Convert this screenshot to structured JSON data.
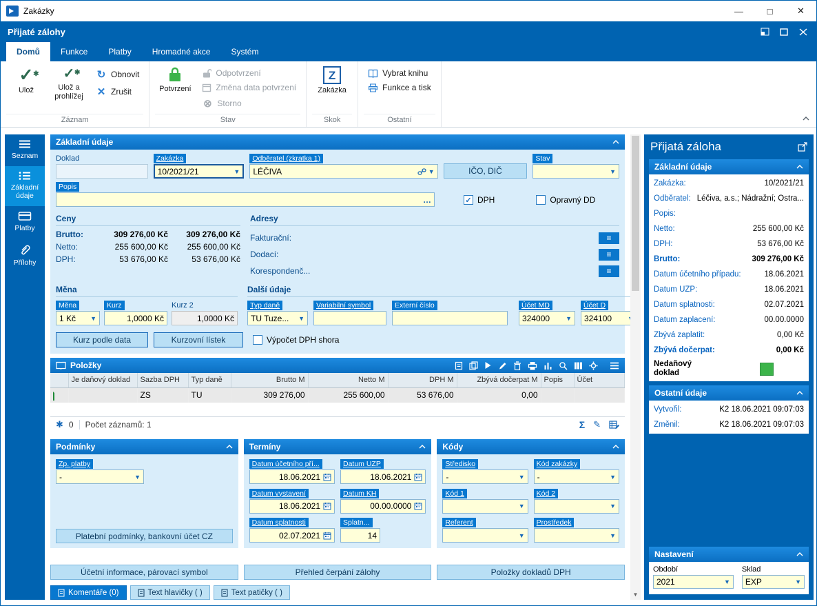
{
  "titlebar": {
    "title": "Zakázky"
  },
  "appbar": {
    "title": "Přijaté zálohy"
  },
  "ribbon": {
    "tabs": [
      {
        "label": "Domů"
      },
      {
        "label": "Funkce"
      },
      {
        "label": "Platby"
      },
      {
        "label": "Hromadné akce"
      },
      {
        "label": "Systém"
      }
    ],
    "buttons": {
      "save": "Ulož",
      "save_and_view": "Ulož a prohlížej",
      "refresh": "Obnovit",
      "cancel": "Zrušit",
      "confirm": "Potvrzení",
      "unconfirm": "Odpotvrzení",
      "change_confirm_date": "Změna data potvrzení",
      "storno": "Storno",
      "jump_zakazka": "Zakázka",
      "z_letter": "Z",
      "select_book": "Vybrat knihu",
      "functions_print": "Funkce a tisk"
    },
    "groups": {
      "zaznam": "Záznam",
      "stav": "Stav",
      "skok": "Skok",
      "ostatni": "Ostatní"
    }
  },
  "sidebar": {
    "items": [
      {
        "label": "Seznam"
      },
      {
        "label": "Základní údaje"
      },
      {
        "label": "Platby"
      },
      {
        "label": "Přílohy"
      }
    ]
  },
  "form": {
    "title": "Základní údaje",
    "doklad_label": "Doklad",
    "zakazka_label": "Zakázka",
    "zakazka_value": "10/2021/21",
    "odberatel_label": "Odběratel (zkratka 1)",
    "odberatel_value": "LÉČIVA",
    "ico_dic_button": "IČO, DIČ",
    "stav_label": "Stav",
    "popis_label": "Popis",
    "dph_checkbox": "DPH",
    "opravny_dd_checkbox": "Opravný DD",
    "ceny": {
      "title": "Ceny",
      "rows": [
        {
          "label": "Brutto:",
          "v1": "309 276,00 Kč",
          "v2": "309 276,00 Kč"
        },
        {
          "label": "Netto:",
          "v1": "255 600,00 Kč",
          "v2": "255 600,00 Kč"
        },
        {
          "label": "DPH:",
          "v1": "53 676,00 Kč",
          "v2": "53 676,00 Kč"
        }
      ]
    },
    "adresy": {
      "title": "Adresy",
      "rows": [
        {
          "label": "Fakturační:"
        },
        {
          "label": "Dodací:"
        },
        {
          "label": "Korespondenč..."
        }
      ]
    },
    "mena": {
      "title": "Měna",
      "mena_label": "Měna",
      "mena_value": "1 Kč",
      "kurz_label": "Kurz",
      "kurz_value": "1,0000 Kč",
      "kurz2_label": "Kurz 2",
      "kurz2_value": "1,0000 Kč",
      "kurz_podle_data": "Kurz podle data",
      "kurzovni_listek": "Kurzovní lístek",
      "vypocet_dph": "Výpočet DPH shora"
    },
    "dalsi": {
      "title": "Další údaje",
      "typ_dane_label": "Typ daně",
      "typ_dane_value": "TU Tuze...",
      "var_symbol_label": "Variabilní symbol",
      "externi_cislo_label": "Externí číslo",
      "ucet_md_label": "Účet MD",
      "ucet_md_value": "324000",
      "ucet_d_label": "Účet D",
      "ucet_d_value": "324100"
    }
  },
  "polozky": {
    "title": "Položky",
    "columns": [
      "Je daňový doklad",
      "Sazba DPH",
      "Typ daně",
      "Brutto M",
      "Netto M",
      "DPH M",
      "Zbývá dočerpat M",
      "Popis",
      "Účet"
    ],
    "rows": [
      {
        "sazba": "ZS",
        "typ": "TU",
        "brutto": "309 276,00",
        "netto": "255 600,00",
        "dph": "53 676,00",
        "zbyva": "0,00",
        "popis": "",
        "ucet": ""
      }
    ],
    "footer": {
      "locked_count": "0",
      "records": "Počet záznamů: 1"
    }
  },
  "podminky": {
    "title": "Podmínky",
    "zp_platby_label": "Zp. platby",
    "zp_platby_value": "-",
    "button": "Platební podmínky, bankovní účet CZ"
  },
  "terminy": {
    "title": "Termíny",
    "fields": [
      {
        "label": "Datum účetního pří...",
        "value": "18.06.2021"
      },
      {
        "label": "Datum UZP",
        "value": "18.06.2021"
      },
      {
        "label": "Datum vystavení",
        "value": "18.06.2021"
      },
      {
        "label": "Datum KH",
        "value": "00.00.0000"
      },
      {
        "label": "Datum splatnosti",
        "value": "02.07.2021"
      },
      {
        "label": "Splatn...",
        "value": "14"
      }
    ]
  },
  "kody": {
    "title": "Kódy",
    "fields": [
      {
        "label": "Středisko",
        "value": "-"
      },
      {
        "label": "Kód zakázky",
        "value": "-"
      },
      {
        "label": "Kód 1",
        "value": ""
      },
      {
        "label": "Kód 2",
        "value": ""
      },
      {
        "label": "Referent",
        "value": ""
      },
      {
        "label": "Prostředek",
        "value": ""
      }
    ]
  },
  "bottom_buttons": [
    {
      "label": "Účetní informace, párovací symbol"
    },
    {
      "label": "Přehled čerpání zálohy"
    },
    {
      "label": "Položky dokladů DPH"
    }
  ],
  "bottom_tabs": [
    {
      "label": "Komentáře (0)"
    },
    {
      "label": "Text hlavičky ( )"
    },
    {
      "label": "Text patičky ( )"
    }
  ],
  "right": {
    "title": "Přijatá záloha",
    "zakladni": {
      "title": "Základní údaje",
      "rows": [
        {
          "label": "Zakázka:",
          "value": "10/2021/21"
        },
        {
          "label": "Odběratel:",
          "value": "Léčiva, a.s.; Nádražní; Ostra..."
        },
        {
          "label": "Popis:",
          "value": ""
        },
        {
          "label": "Netto:",
          "value": "255 600,00 Kč"
        },
        {
          "label": "DPH:",
          "value": "53 676,00 Kč"
        },
        {
          "label": "Brutto:",
          "value": "309 276,00 Kč"
        },
        {
          "label": "Datum účetního případu:",
          "value": "18.06.2021"
        },
        {
          "label": "Datum UZP:",
          "value": "18.06.2021"
        },
        {
          "label": "Datum splatnosti:",
          "value": "02.07.2021"
        },
        {
          "label": "Datum zaplacení:",
          "value": "00.00.0000"
        },
        {
          "label": "Zbývá zaplatit:",
          "value": "0,00 Kč"
        },
        {
          "label": "Zbývá dočerpat:",
          "value": "0,00 Kč"
        },
        {
          "label": "Nedaňový doklad",
          "value": ""
        }
      ]
    },
    "ostatni": {
      "title": "Ostatní údaje",
      "rows": [
        {
          "label": "Vytvořil:",
          "value": "K2 18.06.2021 09:07:03"
        },
        {
          "label": "Změnil:",
          "value": "K2 18.06.2021 09:07:03"
        }
      ]
    },
    "nastaveni": {
      "title": "Nastavení",
      "obdobi_label": "Období",
      "obdobi_value": "2021",
      "sklad_label": "Sklad",
      "sklad_value": "EXP"
    }
  }
}
